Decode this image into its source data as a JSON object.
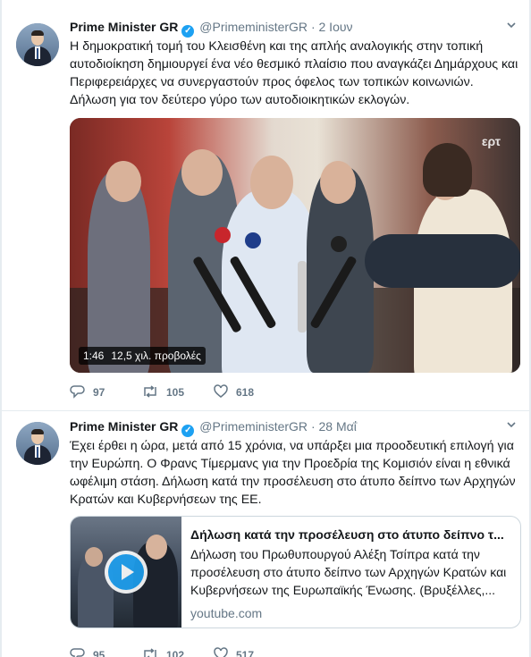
{
  "tweets": [
    {
      "author": "Prime Minister GR",
      "handle": "@PrimeministerGR",
      "separator": "·",
      "date": "2 Ιουν",
      "text": "Η δημοκρατική τομή του Κλεισθένη και της απλής αναλογικής στην τοπική αυτοδιοίκηση δημιουργεί ένα νέο θεσμικό πλαίσιο που αναγκάζει Δημάρχους και Περιφερειάρχες να συνεργαστούν προς όφελος των τοπικών κοινωνιών. Δήλωση για τον δεύτερο γύρο των αυτοδιοικητικών εκλογών.",
      "video": {
        "duration": "1:46",
        "views": "12,5 χιλ. προβολές",
        "channel_logo": "ερτ"
      },
      "actions": {
        "replies": "97",
        "retweets": "105",
        "likes": "618"
      }
    },
    {
      "author": "Prime Minister GR",
      "handle": "@PrimeministerGR",
      "separator": "·",
      "date": "28 Μαΐ",
      "text": "Έχει έρθει η ώρα, μετά από 15 χρόνια, να υπάρξει μια προοδευτική επιλογή για την Ευρώπη. Ο Φρανς Τίμερμανς για την Προεδρία της Κομισιόν είναι η εθνικά ωφέλιμη στάση. Δήλωση κατά την προσέλευση στο άτυπο δείπνο των Αρχηγών Κρατών και Κυβερνήσεων της ΕΕ.",
      "card": {
        "title": "Δήλωση κατά την προσέλευση στο άτυπο δείπνο τ...",
        "description": "Δήλωση του Πρωθυπουργού Αλέξη Τσίπρα κατά την προσέλευση στο άτυπο δείπνο των Αρχηγών Κρατών και Κυβερνήσεων της Ευρωπαϊκής Ένωσης. (Βρυξέλλες,...",
        "domain": "youtube.com"
      },
      "actions": {
        "replies": "95",
        "retweets": "102",
        "likes": "517"
      }
    }
  ],
  "icons": {
    "verified": "verified-badge-icon",
    "reply": "reply-icon",
    "retweet": "retweet-icon",
    "like": "heart-icon",
    "more": "chevron-down-icon",
    "play": "play-icon"
  },
  "colors": {
    "accent": "#1da1f2",
    "secondary_text": "#657786",
    "border": "#e6ecf0"
  }
}
